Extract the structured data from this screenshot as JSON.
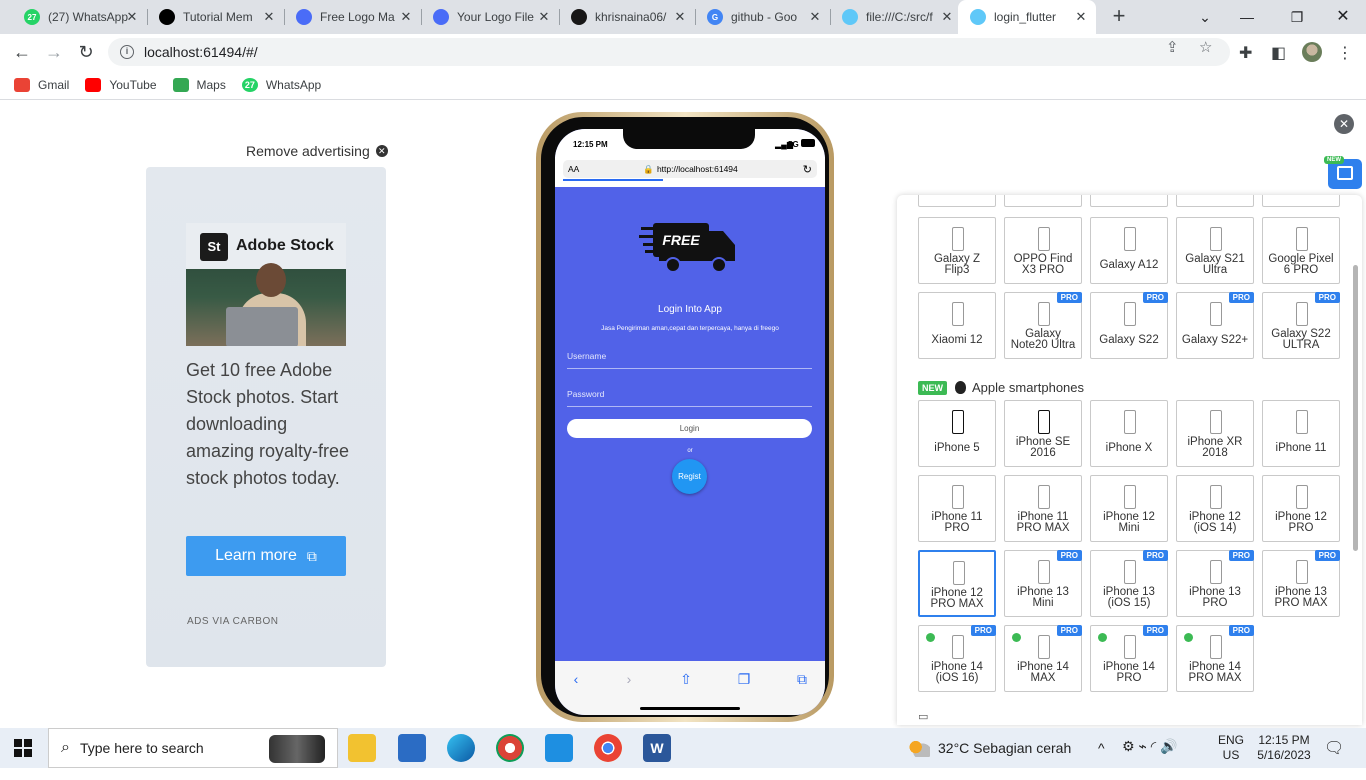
{
  "browser": {
    "tabs": [
      {
        "title": "(27) WhatsApp",
        "favicon": "whatsapp-icon",
        "color": "#25d366",
        "badge": "27"
      },
      {
        "title": "Tutorial Mem",
        "favicon": "medium-icon",
        "color": "#000000",
        "badge": ""
      },
      {
        "title": "Free Logo Ma",
        "favicon": "flutterflow-icon",
        "color": "#4a6cf7",
        "badge": ""
      },
      {
        "title": "Your Logo File",
        "favicon": "flutterflow-icon",
        "color": "#4a6cf7",
        "badge": ""
      },
      {
        "title": "khrisnaina06/",
        "favicon": "github-icon",
        "color": "#181717",
        "badge": ""
      },
      {
        "title": "github - Goo",
        "favicon": "google-icon",
        "color": "#4285f4",
        "badge": "G"
      },
      {
        "title": "file:///C:/src/f",
        "favicon": "flutter-icon",
        "color": "#5fc8f8",
        "badge": ""
      },
      {
        "title": "login_flutter",
        "favicon": "flutter-icon",
        "color": "#5fc8f8",
        "badge": "",
        "active": true
      }
    ],
    "url": "localhost:61494/#/",
    "bookmarks": [
      {
        "label": "Gmail",
        "icon": "gmail-icon",
        "color": "#ea4335"
      },
      {
        "label": "YouTube",
        "icon": "youtube-icon",
        "color": "#ff0000"
      },
      {
        "label": "Maps",
        "icon": "maps-icon",
        "color": "#34a853"
      },
      {
        "label": "WhatsApp",
        "icon": "whatsapp-icon",
        "color": "#25d366",
        "badge": "27"
      }
    ]
  },
  "ad": {
    "remove_label": "Remove advertising",
    "brand_logo": "St",
    "brand_name": "Adobe Stock",
    "text": "Get 10 free Adobe Stock photos. Start downloading amazing royalty-free stock photos today.",
    "cta": "Learn more",
    "footer": "ADS VIA CARBON"
  },
  "phone": {
    "time": "12:15 PM",
    "network": "5G",
    "url_aa": "AA",
    "url": "http://localhost:61494",
    "app": {
      "logo_text": "FREE",
      "title": "Login Into App",
      "subtitle": "Jasa Pengiriman aman,cepat dan terpercaya, hanya di freego",
      "username_placeholder": "Username",
      "password_placeholder": "Password",
      "login_label": "Login",
      "or_label": "or",
      "regist_label": "Regist"
    }
  },
  "device_panel": {
    "new_badge": "NEW",
    "apple_section": "Apple smartphones",
    "android_row1": [
      {
        "label": "Galaxy Z Flip3",
        "pro": false
      },
      {
        "label": "OPPO Find X3 PRO",
        "pro": false
      },
      {
        "label": "Galaxy A12",
        "pro": false
      },
      {
        "label": "Galaxy S21 Ultra",
        "pro": false
      },
      {
        "label": "Google Pixel 6 PRO",
        "pro": false
      }
    ],
    "android_row2": [
      {
        "label": "Xiaomi 12",
        "pro": false
      },
      {
        "label": "Galaxy Note20 Ultra",
        "pro": true
      },
      {
        "label": "Galaxy S22",
        "pro": true
      },
      {
        "label": "Galaxy S22+",
        "pro": true
      },
      {
        "label": "Galaxy S22 ULTRA",
        "pro": true
      }
    ],
    "apple_rows": [
      [
        {
          "label": "iPhone 5",
          "pro": false
        },
        {
          "label": "iPhone SE 2016",
          "pro": false
        },
        {
          "label": "iPhone X",
          "pro": false
        },
        {
          "label": "iPhone XR 2018",
          "pro": false
        },
        {
          "label": "iPhone 11",
          "pro": false
        }
      ],
      [
        {
          "label": "iPhone 11 PRO",
          "pro": false
        },
        {
          "label": "iPhone 11 PRO MAX",
          "pro": false
        },
        {
          "label": "iPhone 12 Mini",
          "pro": false
        },
        {
          "label": "iPhone 12 (iOS 14)",
          "pro": false
        },
        {
          "label": "iPhone 12 PRO",
          "pro": false
        }
      ],
      [
        {
          "label": "iPhone 12 PRO MAX",
          "pro": false,
          "selected": true
        },
        {
          "label": "iPhone 13 Mini",
          "pro": true
        },
        {
          "label": "iPhone 13 (iOS 15)",
          "pro": true
        },
        {
          "label": "iPhone 13 PRO",
          "pro": true
        },
        {
          "label": "iPhone 13 PRO MAX",
          "pro": true
        }
      ],
      [
        {
          "label": "iPhone 14 (iOS 16)",
          "pro": true,
          "dot": true
        },
        {
          "label": "iPhone 14 MAX",
          "pro": true,
          "dot": true
        },
        {
          "label": "iPhone 14 PRO",
          "pro": true,
          "dot": true
        },
        {
          "label": "iPhone 14 PRO MAX",
          "pro": true,
          "dot": true
        }
      ]
    ],
    "pro_badge": "PRO"
  },
  "taskbar": {
    "search_placeholder": "Type here to search",
    "weather": "32°C  Sebagian cerah",
    "lang_top": "ENG",
    "lang_bottom": "US",
    "time": "12:15 PM",
    "date": "5/16/2023"
  }
}
